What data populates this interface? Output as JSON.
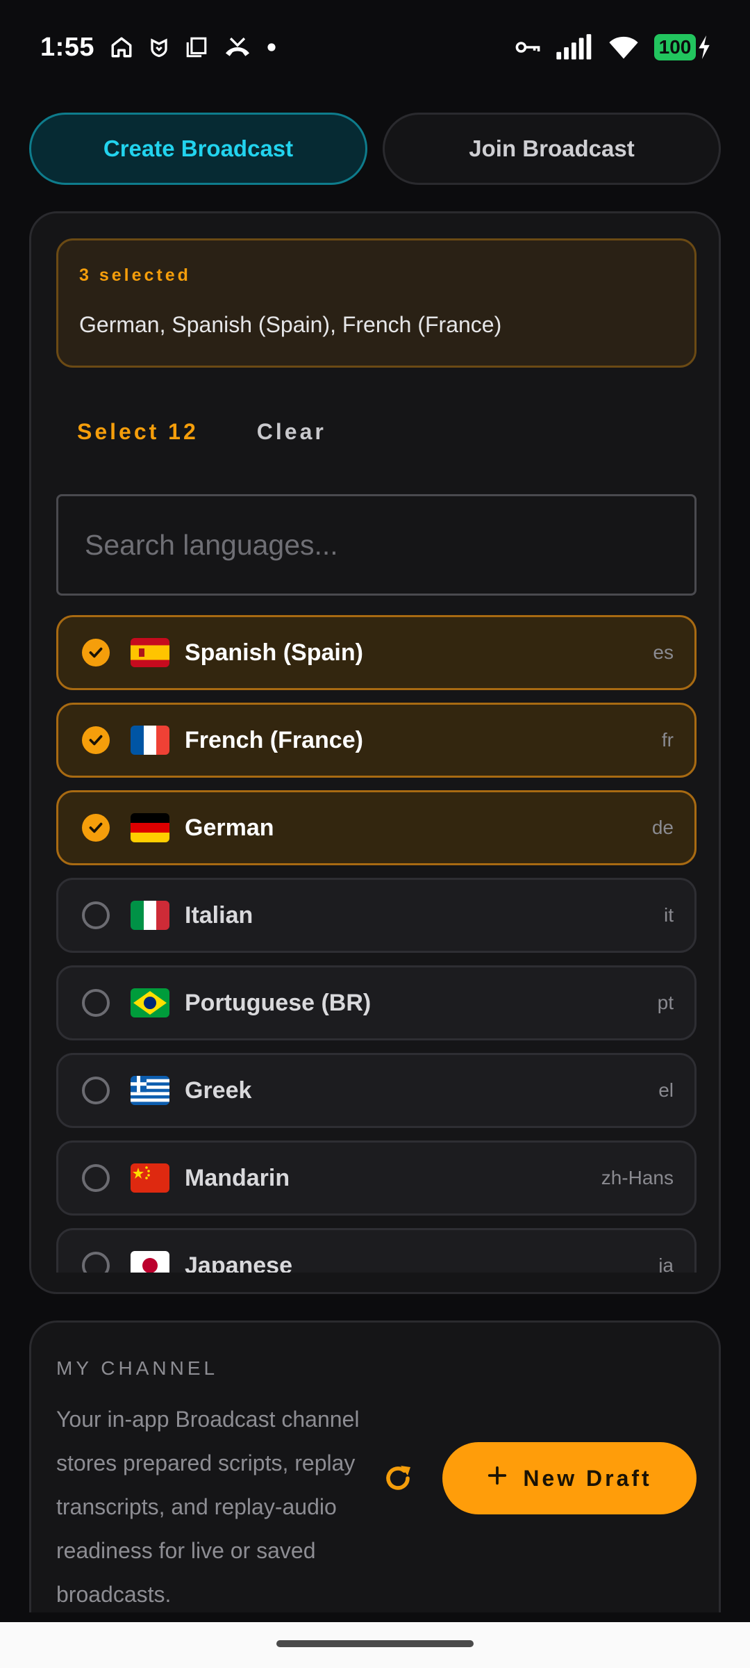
{
  "status_bar": {
    "time": "1:55",
    "battery": "100",
    "icons": [
      "home-icon",
      "shield-icon",
      "copy-icon",
      "missed-call-icon",
      "dot-icon",
      "vpn-key-icon",
      "signal-icon",
      "wifi-icon",
      "battery-icon",
      "charging-icon"
    ]
  },
  "tabs": {
    "create": "Create Broadcast",
    "join": "Join Broadcast"
  },
  "selection": {
    "count_label": "3 selected",
    "list": "German, Spanish (Spain), French (France)",
    "select_all": "Select 12",
    "clear": "Clear"
  },
  "search": {
    "placeholder": "Search languages..."
  },
  "languages": [
    {
      "name": "Spanish (Spain)",
      "code": "es",
      "selected": true,
      "flag": "es"
    },
    {
      "name": "French (France)",
      "code": "fr",
      "selected": true,
      "flag": "fr"
    },
    {
      "name": "German",
      "code": "de",
      "selected": true,
      "flag": "de"
    },
    {
      "name": "Italian",
      "code": "it",
      "selected": false,
      "flag": "it"
    },
    {
      "name": "Portuguese (BR)",
      "code": "pt",
      "selected": false,
      "flag": "br"
    },
    {
      "name": "Greek",
      "code": "el",
      "selected": false,
      "flag": "gr"
    },
    {
      "name": "Mandarin",
      "code": "zh-Hans",
      "selected": false,
      "flag": "cn"
    },
    {
      "name": "Japanese",
      "code": "ja",
      "selected": false,
      "flag": "jp"
    }
  ],
  "channel": {
    "title": "MY CHANNEL",
    "description": "Your in-app Broadcast channel stores prepared scripts, replay transcripts, and replay-audio readiness for live or saved broadcasts.",
    "new_draft": "New Draft"
  },
  "colors": {
    "accent_cyan": "#22d3ee",
    "accent_orange": "#f59e0b",
    "button_orange": "#ff9d0a",
    "background": "#0c0c0e",
    "card": "#151517"
  }
}
